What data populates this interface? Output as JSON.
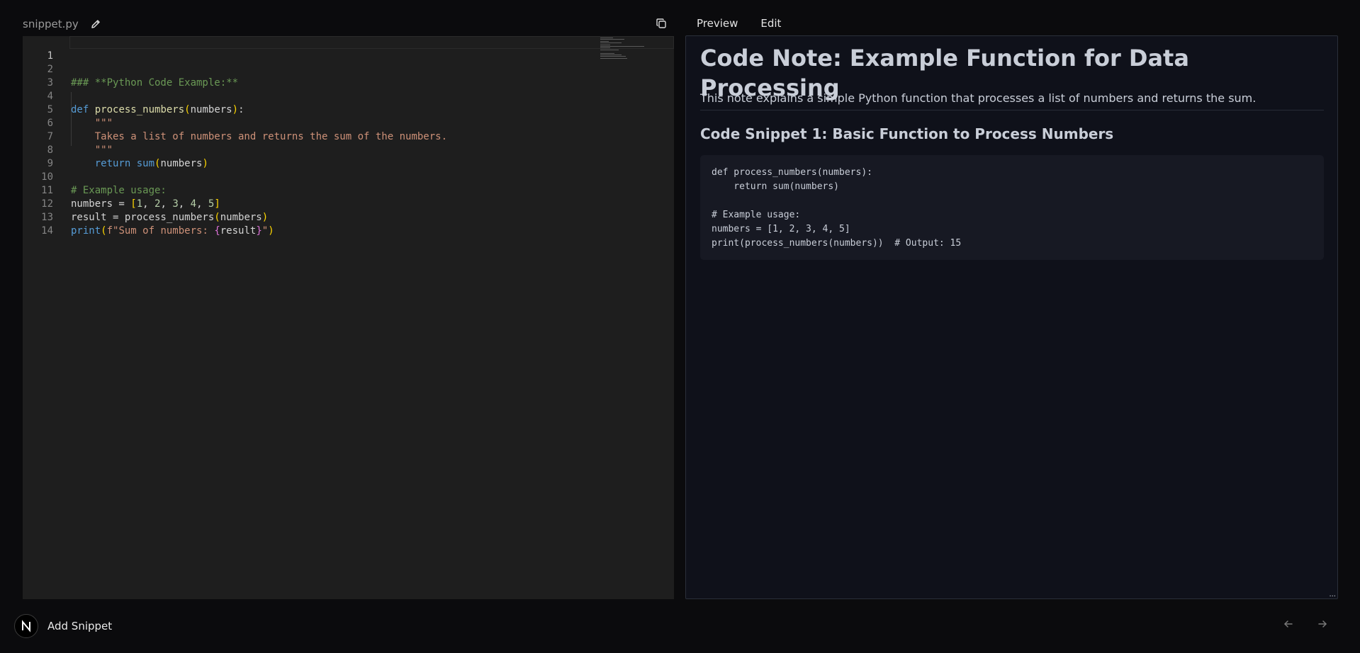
{
  "header": {
    "filename": "snippet.py",
    "tabs": [
      {
        "label": "Preview"
      },
      {
        "label": "Edit"
      }
    ]
  },
  "editor": {
    "line_numbers": [
      "1",
      "2",
      "3",
      "4",
      "5",
      "6",
      "7",
      "8",
      "9",
      "10",
      "11",
      "12",
      "13",
      "14"
    ],
    "active_line": 1,
    "code": {
      "l2": "### **Python Code Example:**",
      "l4_def": "def",
      "l4_fn": "process_numbers",
      "l4_open": "(",
      "l4_arg": "numbers",
      "l4_close": ")",
      "l4_colon": ":",
      "l5": "\"\"\"",
      "l6": "Takes a list of numbers and returns the sum of the numbers.",
      "l7": "\"\"\"",
      "l8_return": "return",
      "l8_fn": "sum",
      "l8_open": "(",
      "l8_arg": "numbers",
      "l8_close": ")",
      "l10": "# Example usage:",
      "l11_var": "numbers = ",
      "l11_open": "[",
      "l11_items": [
        "1",
        "2",
        "3",
        "4",
        "5"
      ],
      "l11_close": "]",
      "l12_var": "result = process_numbers",
      "l12_open": "(",
      "l12_arg": "numbers",
      "l12_close": ")",
      "l13_fn": "print",
      "l13_open": "(",
      "l13_str": "f\"Sum of numbers: ",
      "l13_bo": "{",
      "l13_var": "result",
      "l13_bc": "}",
      "l13_end": "\"",
      "l13_close": ")"
    }
  },
  "preview": {
    "title": "Code Note: Example Function for Data Processing",
    "paragraph": "This note explains a simple Python function that processes a list of numbers and returns the sum.",
    "heading": "Code Snippet 1: Basic Function to Process Numbers",
    "code_block": "def process_numbers(numbers):\n    return sum(numbers)\n\n# Example usage:\nnumbers = [1, 2, 3, 4, 5]\nprint(process_numbers(numbers))  # Output: 15"
  },
  "footer": {
    "add_snippet_label": "Add Snippet",
    "logo_letter": "N"
  },
  "icons": {
    "edit": "pencil-icon",
    "copy": "copy-icon",
    "prev": "arrow-left-icon",
    "next": "arrow-right-icon"
  }
}
